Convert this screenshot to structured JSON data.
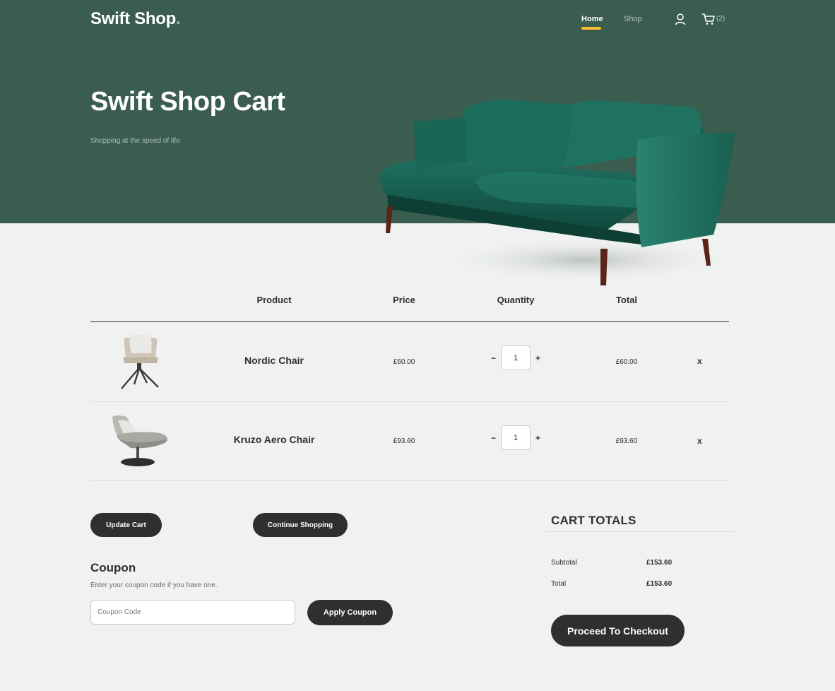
{
  "header": {
    "logo": "Swift Shop",
    "logo_dot": ".",
    "nav": {
      "home": "Home",
      "shop": "Shop"
    },
    "cart_count": "(2)"
  },
  "hero": {
    "title": "Swift Shop Cart",
    "subtitle": "Shopping at the speed of life"
  },
  "table": {
    "headers": {
      "product": "Product",
      "price": "Price",
      "quantity": "Quantity",
      "total": "Total"
    },
    "rows": [
      {
        "name": "Nordic Chair",
        "price": "£60.00",
        "quantity": "1",
        "total": "£60.00",
        "minus": "−",
        "plus": "+",
        "remove": "x"
      },
      {
        "name": "Kruzo Aero Chair",
        "price": "£93.60",
        "quantity": "1",
        "total": "£93.60",
        "minus": "−",
        "plus": "+",
        "remove": "x"
      }
    ]
  },
  "actions": {
    "update_cart": "Update Cart",
    "continue_shopping": "Continue Shopping"
  },
  "coupon": {
    "title": "Coupon",
    "hint": "Enter your coupon code if you have one.",
    "placeholder": "Coupon Code",
    "apply": "Apply Coupon"
  },
  "totals": {
    "title": "CART TOTALS",
    "subtotal_label": "Subtotal",
    "subtotal_value": "£153.60",
    "total_label": "Total",
    "total_value": "£153.60",
    "checkout": "Proceed To Checkout"
  },
  "colors": {
    "hero_bg": "#3b5d50",
    "accent": "#f9bf29",
    "button_dark": "#2f2f2f",
    "page_bg": "#eff2f1"
  }
}
